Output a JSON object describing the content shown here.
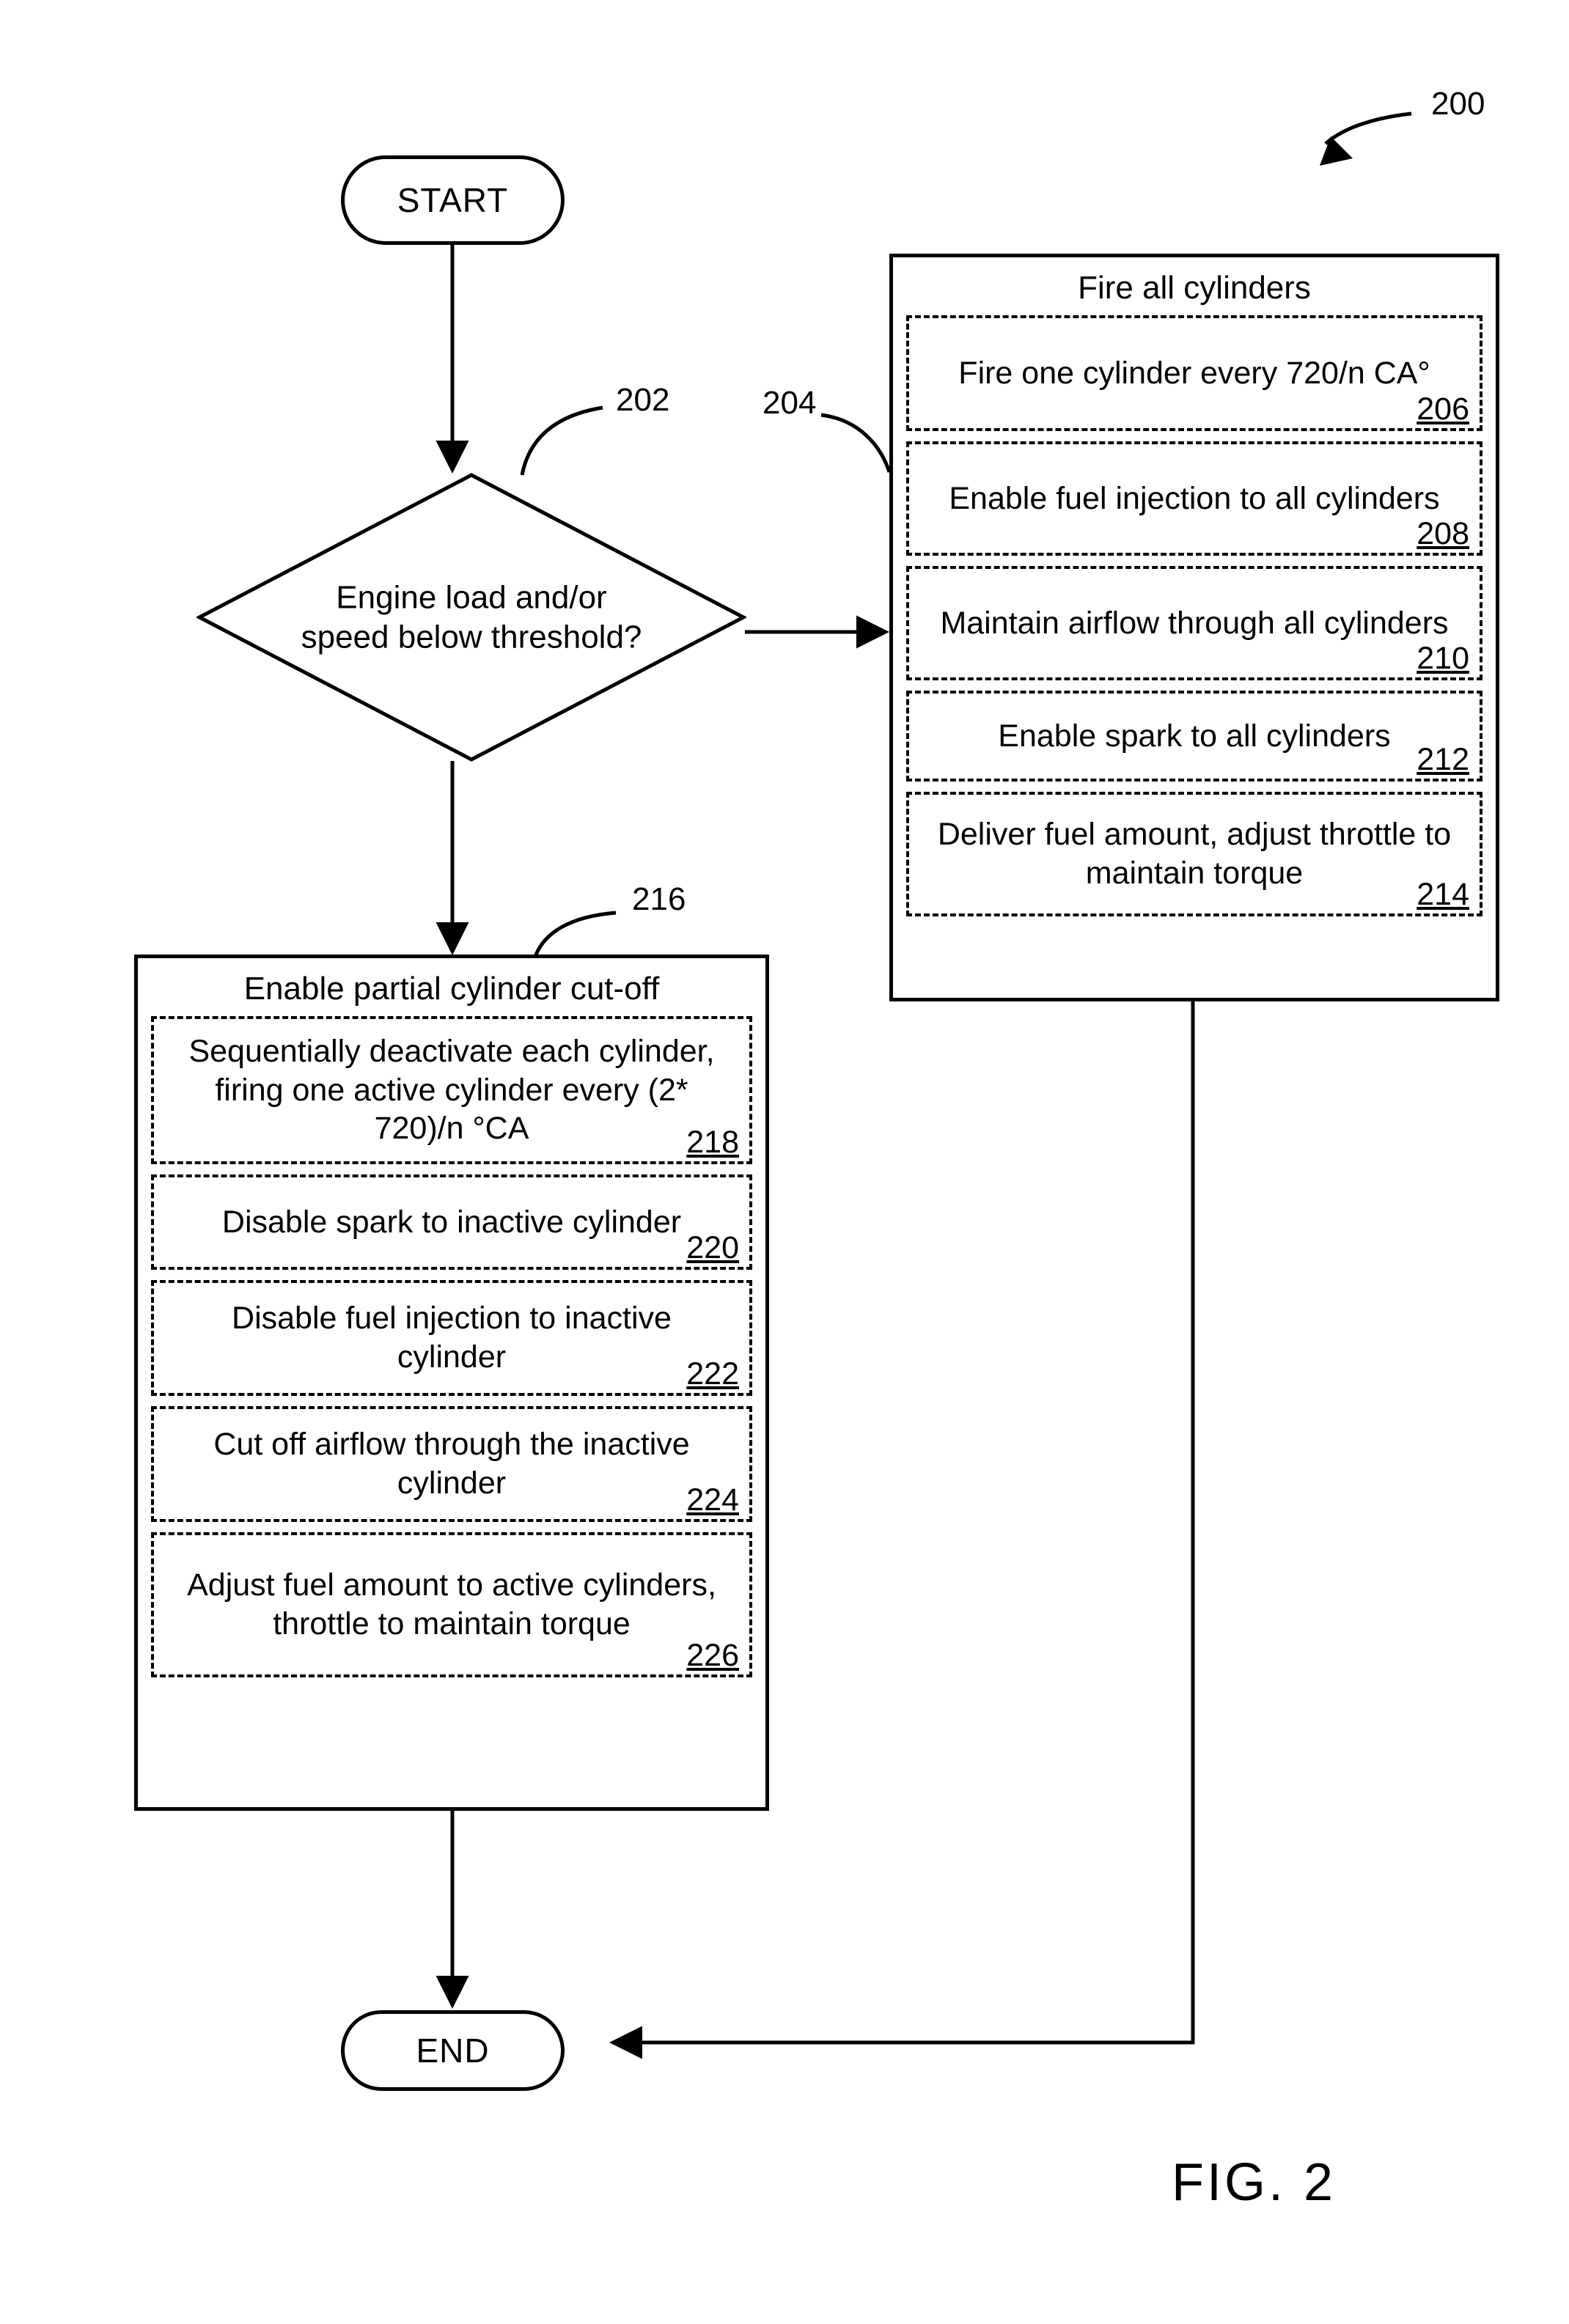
{
  "figure": {
    "caption": "FIG. 2",
    "ref_number": "200"
  },
  "nodes": {
    "start": {
      "label": "START"
    },
    "end": {
      "label": "END"
    },
    "decision": {
      "ref": "202",
      "line1": "Engine load and/or",
      "line2": "speed below threshold?"
    },
    "fire_all": {
      "ref": "204",
      "title": "Fire all cylinders",
      "steps": [
        {
          "text": "Fire one cylinder every 720/n CA°",
          "ref": "206"
        },
        {
          "text": "Enable fuel injection to all cylinders",
          "ref": "208"
        },
        {
          "text": "Maintain airflow through all cylinders",
          "ref": "210"
        },
        {
          "text": "Enable spark to all cylinders",
          "ref": "212"
        },
        {
          "text": "Deliver fuel amount, adjust throttle to maintain torque",
          "ref": "214"
        }
      ]
    },
    "partial_cutoff": {
      "ref": "216",
      "title": "Enable partial cylinder cut-off",
      "steps": [
        {
          "text": "Sequentially deactivate each cylinder, firing one active cylinder every (2* 720)/n °CA",
          "ref": "218"
        },
        {
          "text": "Disable spark to inactive cylinder",
          "ref": "220"
        },
        {
          "text": "Disable fuel injection to inactive cylinder",
          "ref": "222"
        },
        {
          "text": "Cut off airflow through the inactive cylinder",
          "ref": "224"
        },
        {
          "text": "Adjust fuel amount to active cylinders, throttle to maintain torque",
          "ref": "226"
        }
      ]
    }
  },
  "colors": {
    "line": "#000000",
    "background": "#ffffff"
  }
}
